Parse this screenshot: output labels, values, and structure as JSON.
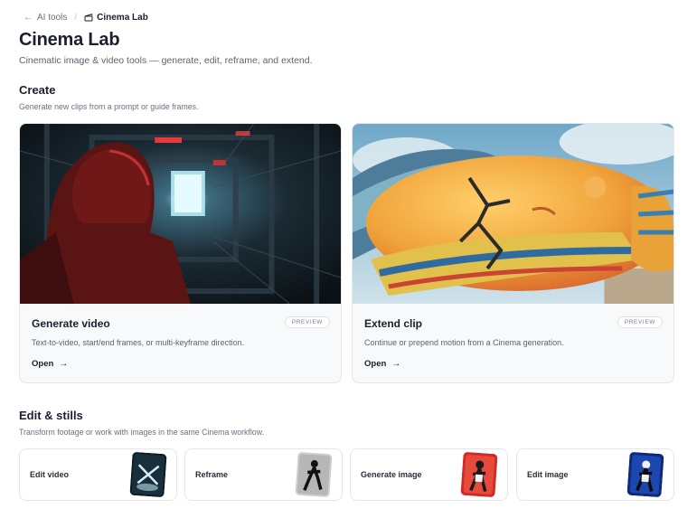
{
  "breadcrumb": {
    "back_label": "AI tools",
    "current": "Cinema Lab"
  },
  "page": {
    "title": "Cinema Lab",
    "subtitle": "Cinematic image & video tools — generate, edit, reframe, and extend."
  },
  "create": {
    "title": "Create",
    "subtitle": "Generate new clips from a prompt or guide frames.",
    "cards": [
      {
        "name": "Generate video",
        "badge": "PREVIEW",
        "description": "Text-to-video, start/end frames, or multi-keyframe direction.",
        "action": "Open"
      },
      {
        "name": "Extend clip",
        "badge": "PREVIEW",
        "description": "Continue or prepend motion from a Cinema generation.",
        "action": "Open"
      }
    ]
  },
  "edit": {
    "title": "Edit & stills",
    "subtitle": "Transform footage or work with images in the same Cinema workflow.",
    "tools": [
      {
        "label": "Edit video",
        "icon": "edit-video-thumbnail"
      },
      {
        "label": "Reframe",
        "icon": "reframe-thumbnail"
      },
      {
        "label": "Generate image",
        "icon": "generate-image-thumbnail"
      },
      {
        "label": "Edit image",
        "icon": "edit-image-thumbnail"
      }
    ]
  },
  "icons": {
    "back": "arrow-left-icon",
    "current": "clapperboard-icon",
    "open": "arrow-right-icon"
  }
}
